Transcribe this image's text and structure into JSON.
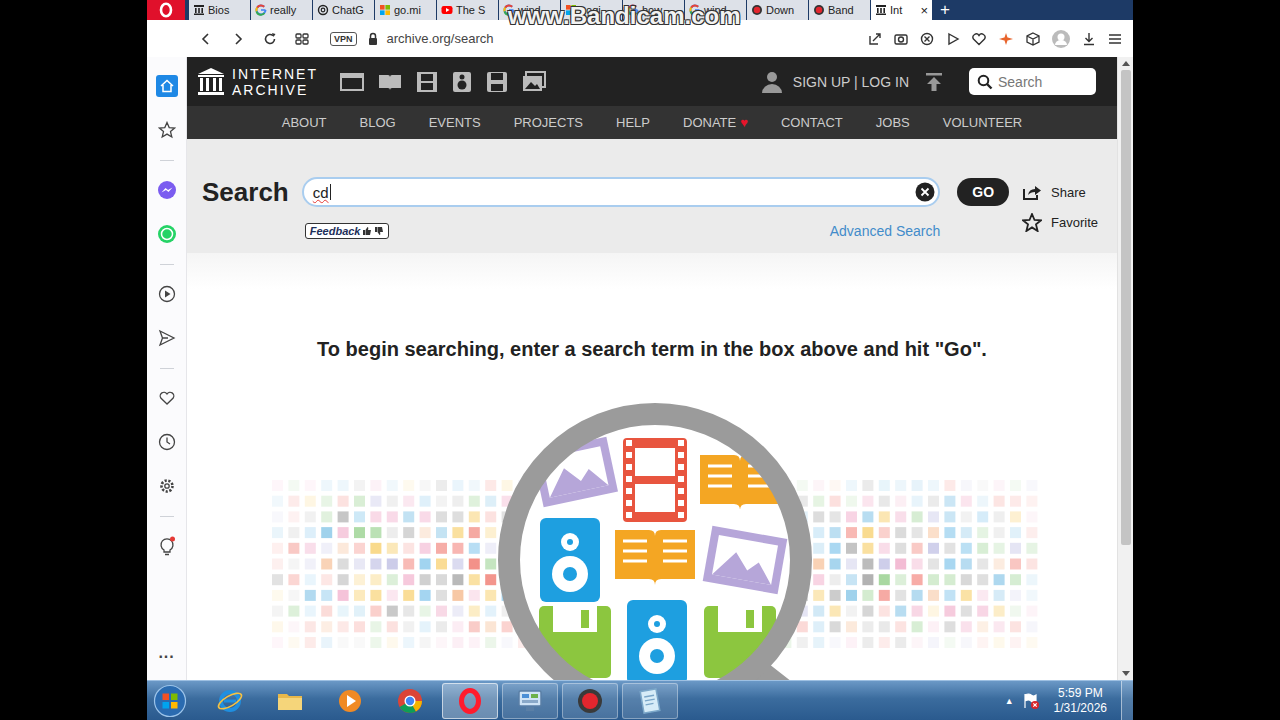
{
  "watermark": "www.Bandicam.com",
  "tabs": [
    {
      "label": "Bios",
      "kind": "ia",
      "selected": false
    },
    {
      "label": "really",
      "kind": "google",
      "selected": false
    },
    {
      "label": "ChatG",
      "kind": "chatgpt",
      "selected": false
    },
    {
      "label": "go.mi",
      "kind": "microsoft",
      "selected": false
    },
    {
      "label": "The S",
      "kind": "youtube",
      "selected": false
    },
    {
      "label": "wind",
      "kind": "google",
      "selected": false
    },
    {
      "label": "Logi",
      "kind": "microsoft",
      "selected": false
    },
    {
      "label": "how",
      "kind": "google",
      "selected": false
    },
    {
      "label": "wind",
      "kind": "google",
      "selected": false
    },
    {
      "label": "Down",
      "kind": "record",
      "selected": false
    },
    {
      "label": "Band",
      "kind": "record",
      "selected": false
    },
    {
      "label": "Int",
      "kind": "ia",
      "selected": true
    }
  ],
  "tab_close": "×",
  "new_tab": "+",
  "address": {
    "vpn": "VPN",
    "url": "archive.org/search"
  },
  "sidebar_more": "···",
  "site": {
    "logo_lines": [
      "INTERNET",
      "ARCHIVE"
    ],
    "auth": "SIGN UP | LOG IN",
    "search_placeholder": "Search",
    "nav": [
      {
        "label": "ABOUT",
        "mark": ""
      },
      {
        "label": "BLOG",
        "mark": ""
      },
      {
        "label": "EVENTS",
        "mark": ""
      },
      {
        "label": "PROJECTS",
        "mark": ""
      },
      {
        "label": "HELP",
        "mark": ""
      },
      {
        "label": "DONATE",
        "mark": "♥"
      },
      {
        "label": "CONTACT",
        "mark": ""
      },
      {
        "label": "JOBS",
        "mark": ""
      },
      {
        "label": "VOLUNTEER",
        "mark": ""
      }
    ]
  },
  "search": {
    "title": "Search",
    "query": "cd",
    "go": "GO",
    "share": "Share",
    "favorite": "Favorite",
    "feedback": "Feedback",
    "advanced": "Advanced Search",
    "prompt": "To begin searching, enter a search term in the box above and hit \"Go\"."
  },
  "taskbar": {
    "apps": [
      {
        "kind": "ie",
        "open": false,
        "selected": false
      },
      {
        "kind": "explorer",
        "open": false,
        "selected": false
      },
      {
        "kind": "media",
        "open": false,
        "selected": false
      },
      {
        "kind": "chrome",
        "open": false,
        "selected": false
      },
      {
        "kind": "opera",
        "open": true,
        "selected": true
      },
      {
        "kind": "network",
        "open": true,
        "selected": false
      },
      {
        "kind": "bandicam",
        "open": true,
        "selected": false
      },
      {
        "kind": "notepad",
        "open": true,
        "selected": false
      }
    ],
    "tray_arrow": "▲",
    "time": "5:59 PM",
    "date": "1/31/2026"
  }
}
